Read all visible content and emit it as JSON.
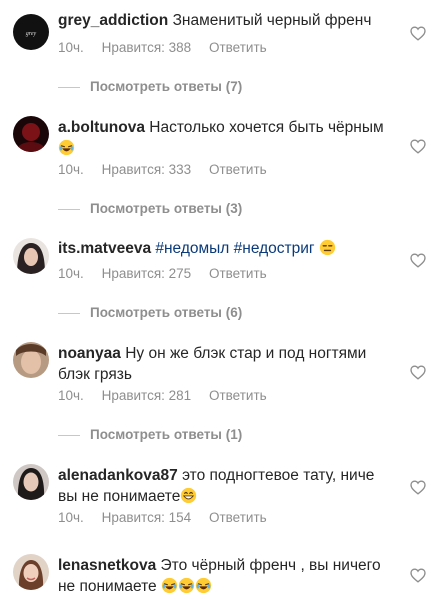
{
  "comments": [
    {
      "username": "grey_addiction",
      "text": "Знаменитый черный френч",
      "time": "10ч.",
      "likes": "Нравится: 388",
      "reply": "Ответить",
      "view_replies": "Посмотреть ответы (7)",
      "avatar_icon": "brand-logo-avatar"
    },
    {
      "username": "a.boltunova",
      "text": "Настолько хочется быть чёрным",
      "time": "10ч.",
      "likes": "Нравится: 333",
      "reply": "Ответить",
      "view_replies": "Посмотреть ответы (3)",
      "emoji": "laughing-face-emoji"
    },
    {
      "username": "its.matveeva",
      "tags": [
        "#недомыл",
        "#недостриг"
      ],
      "time": "10ч.",
      "likes": "Нравится: 275",
      "reply": "Ответить",
      "view_replies": "Посмотреть ответы (6)",
      "emoji": "expressionless-face-emoji"
    },
    {
      "username": "noanyaa",
      "text_line1": "Ну он же блэк стар и под ногтями",
      "text_line2": "блэк грязь",
      "time": "10ч.",
      "likes": "Нравится: 281",
      "reply": "Ответить",
      "view_replies": "Посмотреть ответы (1)"
    },
    {
      "username": "alenadankova87",
      "text_line1": "это подногтевое тату, ниче",
      "text_line2": "вы не понимаете",
      "time": "10ч.",
      "likes": "Нравится: 154",
      "reply": "Ответить",
      "emoji": "grinning-face-emoji"
    },
    {
      "username": "lenasnetkova",
      "text_line1": "Это чёрный френч , вы ничего",
      "text_line2": "не понимаете",
      "emoji": "laughing-face-emoji"
    }
  ],
  "colors": {
    "text": "#262626",
    "muted": "#8e8e8e",
    "hashtag": "#0a3a7a",
    "divider": "#c7c7c7"
  }
}
